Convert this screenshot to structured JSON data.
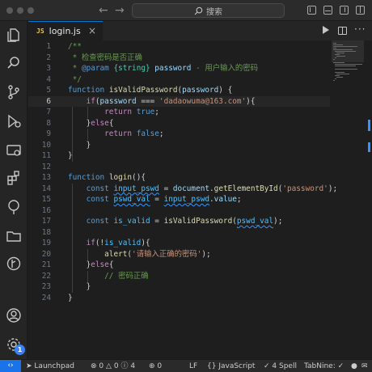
{
  "titlebar": {
    "search_placeholder": "搜索"
  },
  "tab": {
    "file_badge": "JS",
    "file_name": "login.js"
  },
  "editor": {
    "current_line": 6,
    "line_numbers": [
      "1",
      "2",
      "3",
      "4",
      "5",
      "6",
      "7",
      "8",
      "9",
      "10",
      "11",
      "12",
      "13",
      "14",
      "15",
      "16",
      "17",
      "18",
      "19",
      "20",
      "21",
      "22",
      "23",
      "24"
    ]
  },
  "activity_icons": [
    "explorer-icon",
    "search-icon",
    "source-control-icon",
    "run-debug-icon",
    "remote-explorer-icon",
    "extensions-icon",
    "tree-icon",
    "folder-icon",
    "git-graph-icon",
    "account-icon",
    "settings-gear-icon"
  ],
  "settings_badge": "1",
  "statusbar": {
    "launchpad": "Launchpad",
    "errors": "0",
    "warnings": "0",
    "info": "4",
    "ports": "0",
    "eol": "LF",
    "language": "JavaScript",
    "spell": "4 Spell",
    "tabnine": "TabNine:"
  },
  "colors": {
    "accent": "#0078d4",
    "remote_button": "#1a73e8",
    "keyword": "#569cd6",
    "string": "#ce9178",
    "comment": "#6a9955",
    "function": "#dcdcaa",
    "variable": "#9cdcfe"
  }
}
